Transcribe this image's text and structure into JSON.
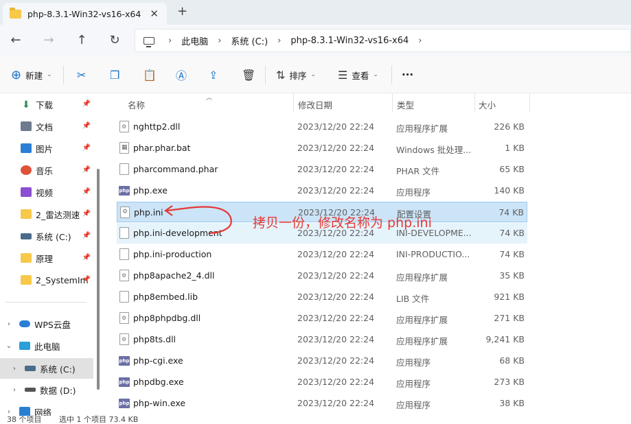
{
  "window": {
    "tab_title": "php-8.3.1-Win32-vs16-x64",
    "tab_close": "✕",
    "tab_add": "+"
  },
  "nav": {
    "back": "←",
    "forward": "→",
    "up": "↑",
    "refresh": "↻",
    "breadcrumbs": [
      "此电脑",
      "系统 (C:)",
      "php-8.3.1-Win32-vs16-x64"
    ],
    "separator": "›"
  },
  "toolbar": {
    "new_label": "新建",
    "sort_label": "排序",
    "view_label": "查看",
    "more_label": "···",
    "icons": [
      "cut-icon",
      "copy-icon",
      "paste-icon",
      "rename-icon",
      "share-icon",
      "delete-icon"
    ]
  },
  "sidebar": {
    "quick": [
      {
        "label": "下载",
        "icon": "download-icon",
        "color": "#2e8b57"
      },
      {
        "label": "文档",
        "icon": "document-icon",
        "color": "#6d7b8d"
      },
      {
        "label": "图片",
        "icon": "picture-icon",
        "color": "#2a7fd4"
      },
      {
        "label": "音乐",
        "icon": "music-icon",
        "color": "#e0533b"
      },
      {
        "label": "视频",
        "icon": "video-icon",
        "color": "#8b4fd1"
      },
      {
        "label": "2_雷达测速",
        "icon": "folder-icon",
        "color": "#f6c94a"
      },
      {
        "label": "系统 (C:)",
        "icon": "drive-icon",
        "color": "#4a6b8a"
      },
      {
        "label": "原理",
        "icon": "folder-icon",
        "color": "#f6c94a"
      },
      {
        "label": "2_SystemIm",
        "icon": "folder-icon",
        "color": "#f6c94a"
      }
    ],
    "tree": [
      {
        "label": "WPS云盘",
        "icon": "cloud-icon",
        "expander": "›",
        "color": "#2a7fd4"
      },
      {
        "label": "此电脑",
        "icon": "computer-icon",
        "expander": "⌄",
        "color": "#2a9fd8"
      },
      {
        "label": "系统 (C:)",
        "icon": "drive-icon",
        "expander": "›",
        "color": "#4a6b8a"
      },
      {
        "label": "数据 (D:)",
        "icon": "drive-icon",
        "expander": "›",
        "color": "#555555"
      },
      {
        "label": "网络",
        "icon": "network-icon",
        "expander": "›",
        "color": "#2a7fd4"
      }
    ]
  },
  "columns": {
    "name": "名称",
    "date": "修改日期",
    "type": "类型",
    "size": "大小"
  },
  "files": [
    {
      "name": "nghttp2.dll",
      "date": "2023/12/20 22:24",
      "type": "应用程序扩展",
      "size": "226 KB",
      "icon": "dll"
    },
    {
      "name": "phar.phar.bat",
      "date": "2023/12/20 22:24",
      "type": "Windows 批处理...",
      "size": "1 KB",
      "icon": "bat"
    },
    {
      "name": "pharcommand.phar",
      "date": "2023/12/20 22:24",
      "type": "PHAR 文件",
      "size": "65 KB",
      "icon": "file"
    },
    {
      "name": "php.exe",
      "date": "2023/12/20 22:24",
      "type": "应用程序",
      "size": "140 KB",
      "icon": "php"
    },
    {
      "name": "php.ini",
      "date": "2023/12/20 22:24",
      "type": "配置设置",
      "size": "74 KB",
      "icon": "gear"
    },
    {
      "name": "php.ini-development",
      "date": "2023/12/20 22:24",
      "type": "INI-DEVELOPME...",
      "size": "74 KB",
      "icon": "file"
    },
    {
      "name": "php.ini-production",
      "date": "2023/12/20 22:24",
      "type": "INI-PRODUCTIO...",
      "size": "74 KB",
      "icon": "file"
    },
    {
      "name": "php8apache2_4.dll",
      "date": "2023/12/20 22:24",
      "type": "应用程序扩展",
      "size": "35 KB",
      "icon": "dll"
    },
    {
      "name": "php8embed.lib",
      "date": "2023/12/20 22:24",
      "type": "LIB 文件",
      "size": "921 KB",
      "icon": "file"
    },
    {
      "name": "php8phpdbg.dll",
      "date": "2023/12/20 22:24",
      "type": "应用程序扩展",
      "size": "271 KB",
      "icon": "dll"
    },
    {
      "name": "php8ts.dll",
      "date": "2023/12/20 22:24",
      "type": "应用程序扩展",
      "size": "9,241 KB",
      "icon": "dll"
    },
    {
      "name": "php-cgi.exe",
      "date": "2023/12/20 22:24",
      "type": "应用程序",
      "size": "68 KB",
      "icon": "php"
    },
    {
      "name": "phpdbg.exe",
      "date": "2023/12/20 22:24",
      "type": "应用程序",
      "size": "273 KB",
      "icon": "php"
    },
    {
      "name": "php-win.exe",
      "date": "2023/12/20 22:24",
      "type": "应用程序",
      "size": "38 KB",
      "icon": "php"
    }
  ],
  "selected_file": "php.ini",
  "hovered_file": "php.ini-development",
  "annotation": {
    "text": "拷贝一份，修改名称为 php.ini",
    "color": "#e53935"
  },
  "status": {
    "item_count": "38 个项目",
    "selection": "选中 1 个项目  73.4 KB"
  },
  "colors": {
    "accent": "#1a73c9",
    "selection_bg": "#cce4f7",
    "php_icon": "#6b6fa6"
  }
}
